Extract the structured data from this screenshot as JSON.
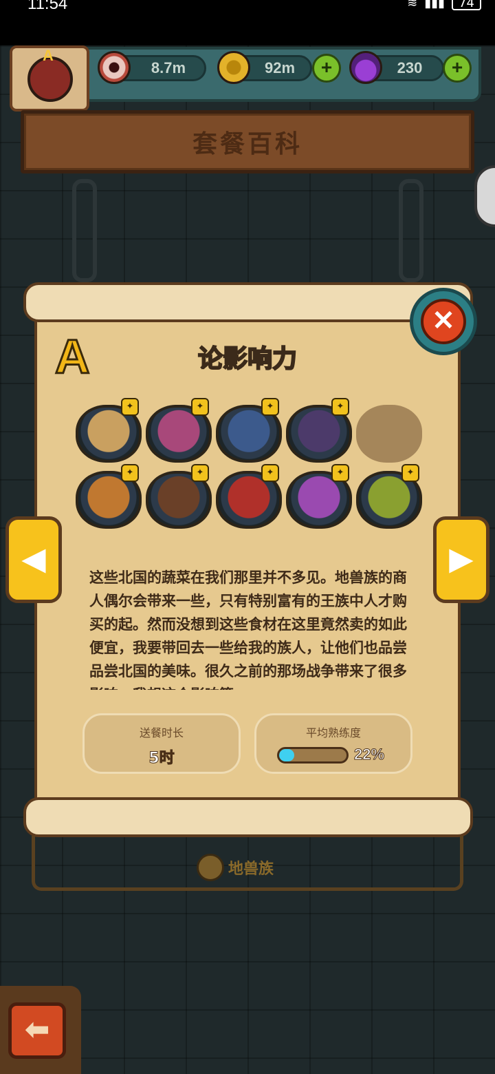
{
  "status": {
    "time": "11:54",
    "battery": "74"
  },
  "hud": {
    "eyes": "8.7m",
    "coins": "92m",
    "potions": "230",
    "plus_label": "+",
    "avatar_letter": "A"
  },
  "page_title": "套餐百科",
  "scroll": {
    "grade": "A",
    "title": "论影响力",
    "close_label": "✕",
    "description": "这些北国的蔬菜在我们那里并不多见。地兽族的商人偶尔会带来一些，只有特别富有的王族中人才购买的起。然而没想到这些食材在这里竟然卖的如此便宜，我要带回去一些给我的族人，让他们也品尝品尝北国的美味。很久之前的那场战争带来了很多影响，我想这个影响算",
    "stats": {
      "delivery_label": "送餐时长",
      "delivery_value": "5时",
      "proficiency_label": "平均熟练度",
      "proficiency_pct": "22%",
      "proficiency_fraction": 0.22
    },
    "dishes": [
      {
        "icon": "grilled-fish-dish-icon",
        "color": "#c9a060",
        "locked": false
      },
      {
        "icon": "layer-cake-dish-icon",
        "color": "#a8487a",
        "locked": false
      },
      {
        "icon": "fried-noodle-dish-icon",
        "color": "#3c5a8c",
        "locked": false
      },
      {
        "icon": "green-noodle-dish-icon",
        "color": "#4c3a6a",
        "locked": false
      },
      {
        "icon": "locked-dish-icon",
        "color": "#8a6a44",
        "locked": true
      },
      {
        "icon": "cabbage-bowl-dish-icon",
        "color": "#c07830",
        "locked": false
      },
      {
        "icon": "skewer-plate-dish-icon",
        "color": "#6a4028",
        "locked": false
      },
      {
        "icon": "meat-soup-dish-icon",
        "color": "#b0302a",
        "locked": false
      },
      {
        "icon": "purple-octopus-dish-icon",
        "color": "#9a4ab0",
        "locked": false
      },
      {
        "icon": "purple-blob-dish-icon",
        "color": "#8aa030",
        "locked": false
      }
    ],
    "badge_glyph": "✦"
  },
  "nav": {
    "prev_glyph": "◀",
    "next_glyph": "▶"
  },
  "race": {
    "label": "地兽族"
  },
  "back_glyph": "⬅"
}
